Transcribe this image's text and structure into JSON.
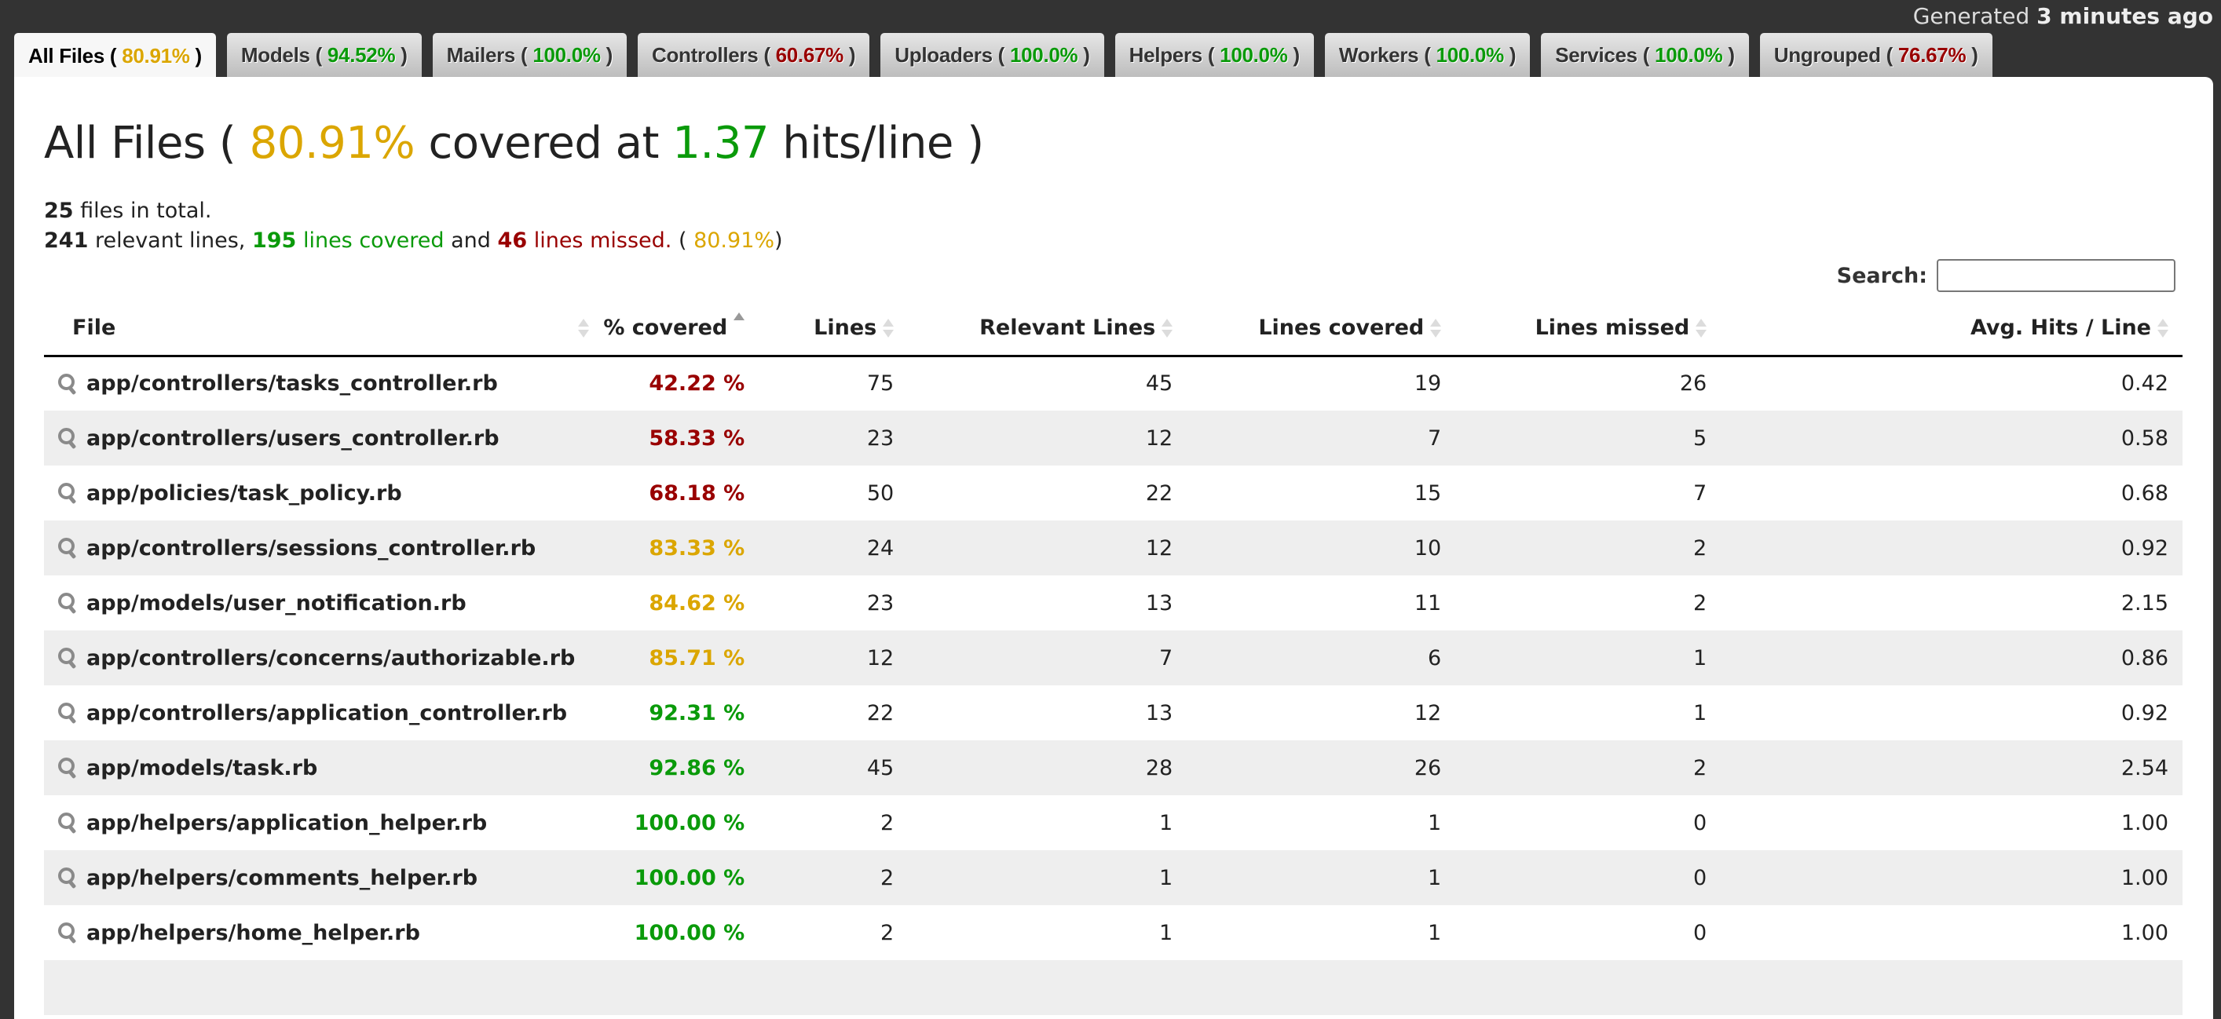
{
  "header": {
    "timestamp_prefix": "Generated",
    "timestamp_value": "3 minutes ago"
  },
  "tabs": [
    {
      "label": "All Files",
      "pct": "80.91%",
      "status": "yellow",
      "active": true
    },
    {
      "label": "Models",
      "pct": "94.52%",
      "status": "green",
      "active": false
    },
    {
      "label": "Mailers",
      "pct": "100.0%",
      "status": "green",
      "active": false
    },
    {
      "label": "Controllers",
      "pct": "60.67%",
      "status": "red",
      "active": false
    },
    {
      "label": "Uploaders",
      "pct": "100.0%",
      "status": "green",
      "active": false
    },
    {
      "label": "Helpers",
      "pct": "100.0%",
      "status": "green",
      "active": false
    },
    {
      "label": "Workers",
      "pct": "100.0%",
      "status": "green",
      "active": false
    },
    {
      "label": "Services",
      "pct": "100.0%",
      "status": "green",
      "active": false
    },
    {
      "label": "Ungrouped",
      "pct": "76.67%",
      "status": "red",
      "active": false
    }
  ],
  "title": {
    "name": "All Files",
    "open": "(",
    "pct": "80.91%",
    "covered_at": "covered at",
    "hits": "1.37",
    "hits_suffix": "hits/line",
    "close": ")"
  },
  "summary": {
    "files_count": "25",
    "files_text": "files in total.",
    "relevant_count": "241",
    "relevant_text": "relevant lines,",
    "covered_count": "195",
    "covered_text": "lines covered",
    "and_text": "and",
    "missed_count": "46",
    "missed_text": "lines missed.",
    "pct": "80.91%"
  },
  "search": {
    "label": "Search:",
    "value": "",
    "placeholder": ""
  },
  "table": {
    "columns": [
      "File",
      "% covered",
      "Lines",
      "Relevant Lines",
      "Lines covered",
      "Lines missed",
      "Avg. Hits / Line"
    ],
    "sorted_column": "% covered",
    "sort_direction": "ascending",
    "rows": [
      {
        "file": "app/controllers/tasks_controller.rb",
        "covered": "42.22 %",
        "status": "red",
        "lines": "75",
        "relevant": "45",
        "lines_covered": "19",
        "missed": "26",
        "avg": "0.42"
      },
      {
        "file": "app/controllers/users_controller.rb",
        "covered": "58.33 %",
        "status": "red",
        "lines": "23",
        "relevant": "12",
        "lines_covered": "7",
        "missed": "5",
        "avg": "0.58"
      },
      {
        "file": "app/policies/task_policy.rb",
        "covered": "68.18 %",
        "status": "red",
        "lines": "50",
        "relevant": "22",
        "lines_covered": "15",
        "missed": "7",
        "avg": "0.68"
      },
      {
        "file": "app/controllers/sessions_controller.rb",
        "covered": "83.33 %",
        "status": "yellow",
        "lines": "24",
        "relevant": "12",
        "lines_covered": "10",
        "missed": "2",
        "avg": "0.92"
      },
      {
        "file": "app/models/user_notification.rb",
        "covered": "84.62 %",
        "status": "yellow",
        "lines": "23",
        "relevant": "13",
        "lines_covered": "11",
        "missed": "2",
        "avg": "2.15"
      },
      {
        "file": "app/controllers/concerns/authorizable.rb",
        "covered": "85.71 %",
        "status": "yellow",
        "lines": "12",
        "relevant": "7",
        "lines_covered": "6",
        "missed": "1",
        "avg": "0.86"
      },
      {
        "file": "app/controllers/application_controller.rb",
        "covered": "92.31 %",
        "status": "green",
        "lines": "22",
        "relevant": "13",
        "lines_covered": "12",
        "missed": "1",
        "avg": "0.92"
      },
      {
        "file": "app/models/task.rb",
        "covered": "92.86 %",
        "status": "green",
        "lines": "45",
        "relevant": "28",
        "lines_covered": "26",
        "missed": "2",
        "avg": "2.54"
      },
      {
        "file": "app/helpers/application_helper.rb",
        "covered": "100.00 %",
        "status": "green",
        "lines": "2",
        "relevant": "1",
        "lines_covered": "1",
        "missed": "0",
        "avg": "1.00"
      },
      {
        "file": "app/helpers/comments_helper.rb",
        "covered": "100.00 %",
        "status": "green",
        "lines": "2",
        "relevant": "1",
        "lines_covered": "1",
        "missed": "0",
        "avg": "1.00"
      },
      {
        "file": "app/helpers/home_helper.rb",
        "covered": "100.00 %",
        "status": "green",
        "lines": "2",
        "relevant": "1",
        "lines_covered": "1",
        "missed": "0",
        "avg": "1.00"
      },
      {
        "file": "",
        "covered": "",
        "status": "",
        "lines": "",
        "relevant": "",
        "lines_covered": "",
        "missed": "",
        "avg": ""
      }
    ]
  },
  "colors": {
    "green": "#0a9a0a",
    "yellow": "#dba600",
    "red": "#990000",
    "background": "#333333",
    "panel": "#ffffff",
    "row_alt": "#eeeeee"
  }
}
